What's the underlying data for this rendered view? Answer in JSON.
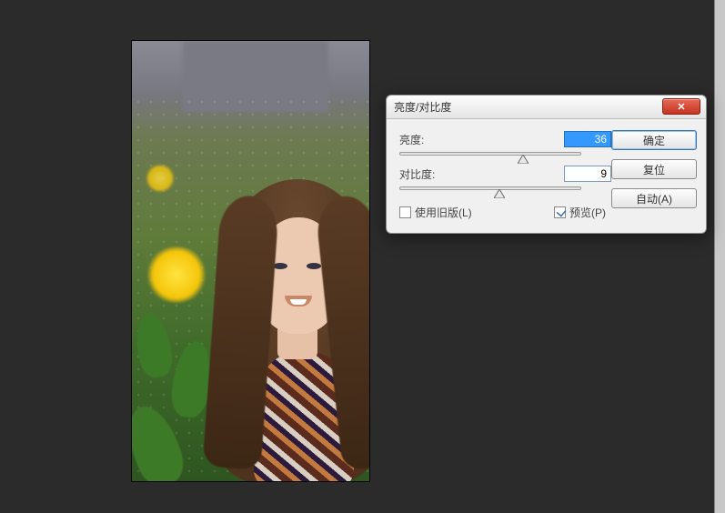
{
  "dialog": {
    "title": "亮度/对比度",
    "brightness": {
      "label": "亮度:",
      "value": "36",
      "percent": 68
    },
    "contrast": {
      "label": "对比度:",
      "value": "9",
      "percent": 55
    },
    "use_legacy": {
      "label": "使用旧版(L)",
      "checked": false
    },
    "preview": {
      "label": "预览(P)",
      "checked": true
    },
    "buttons": {
      "ok": "确定",
      "reset": "复位",
      "auto": "自动(A)"
    },
    "close_icon_glyph": "✕"
  }
}
